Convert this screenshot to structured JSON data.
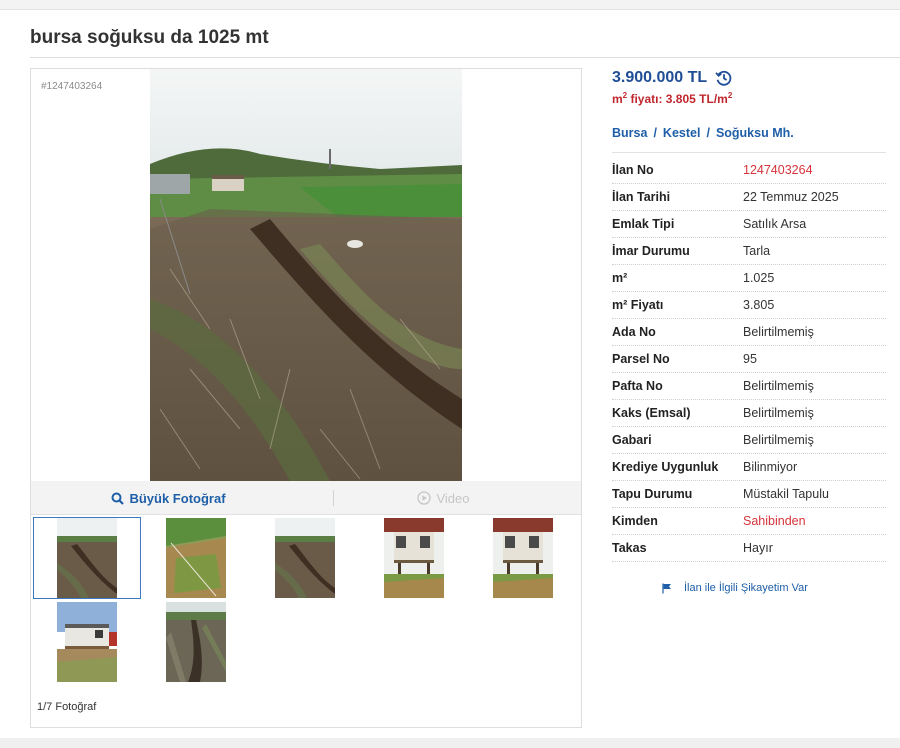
{
  "page": {
    "title": "bursa soğuksu da 1025 mt"
  },
  "gallery": {
    "listing_tag": "#1247403264",
    "big_photo_label": "Büyük Fotoğraf",
    "video_label": "Video",
    "photo_count": "1/7 Fotoğraf",
    "thumbnails": [
      {
        "scene": "field-rows",
        "selected": true
      },
      {
        "scene": "green-field",
        "selected": false
      },
      {
        "scene": "field-rows",
        "selected": false
      },
      {
        "scene": "cabin",
        "selected": false
      },
      {
        "scene": "cabin",
        "selected": false
      },
      {
        "scene": "cabin-closeup",
        "selected": false
      },
      {
        "scene": "tracks",
        "selected": false
      }
    ]
  },
  "info": {
    "price": "3.900.000 TL",
    "unit_price_prefix": "m",
    "unit_price_sup": "2",
    "unit_price_text": " fiyatı: 3.805 TL/m",
    "unit_price_sup2": "2",
    "location": [
      "Bursa",
      "Kestel",
      "Soğuksu Mh."
    ],
    "location_separator": "/",
    "rows": [
      {
        "label": "İlan No",
        "value": "1247403264",
        "highlight": true
      },
      {
        "label": "İlan Tarihi",
        "value": "22 Temmuz 2025",
        "highlight": false
      },
      {
        "label": "Emlak Tipi",
        "value": "Satılık Arsa",
        "highlight": false
      },
      {
        "label": "İmar Durumu",
        "value": "Tarla",
        "highlight": false
      },
      {
        "label": "m²",
        "value": "1.025",
        "highlight": false
      },
      {
        "label": "m² Fiyatı",
        "value": "3.805",
        "highlight": false
      },
      {
        "label": "Ada No",
        "value": "Belirtilmemiş",
        "highlight": false
      },
      {
        "label": "Parsel No",
        "value": "95",
        "highlight": false
      },
      {
        "label": "Pafta No",
        "value": "Belirtilmemiş",
        "highlight": false
      },
      {
        "label": "Kaks (Emsal)",
        "value": "Belirtilmemiş",
        "highlight": false
      },
      {
        "label": "Gabari",
        "value": "Belirtilmemiş",
        "highlight": false
      },
      {
        "label": "Krediye Uygunluk",
        "value": "Bilinmiyor",
        "highlight": false
      },
      {
        "label": "Tapu Durumu",
        "value": "Müstakil Tapulu",
        "highlight": false
      },
      {
        "label": "Kimden",
        "value": "Sahibinden",
        "highlight": true
      },
      {
        "label": "Takas",
        "value": "Hayır",
        "highlight": false
      }
    ],
    "complaint": "İlan ile İlgili Şikayetim Var"
  },
  "colors": {
    "accent_blue": "#1f4e96",
    "link_blue": "#1f5fa8",
    "price_red": "#c0272d",
    "highlight_red": "#d6343a"
  },
  "icons": {
    "history": "history-icon",
    "search": "search-icon",
    "play": "play-icon",
    "flag": "flag-icon"
  }
}
